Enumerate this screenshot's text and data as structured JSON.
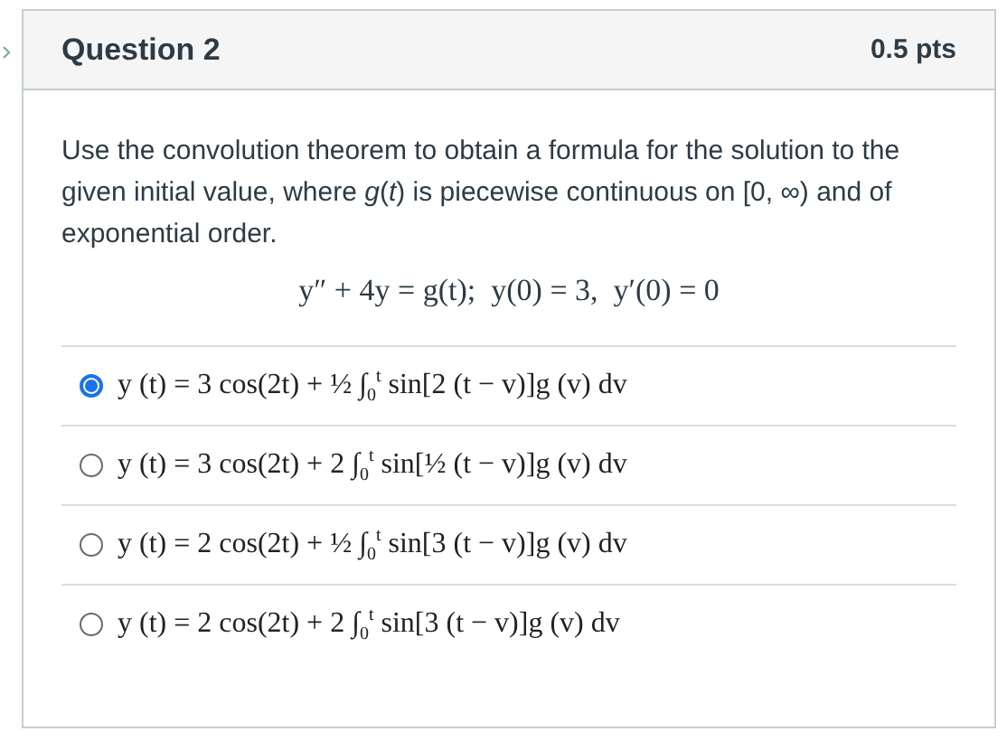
{
  "question": {
    "title": "Question 2",
    "points": "0.5 pts",
    "prompt": "Use the convolution theorem to obtain a formula for the solution to the given initial value, where *g*(*t*) is piecewise continuous on [0, ∞) and of exponential order.",
    "equation": "y″ + 4y = g(t);  y(0) = 3,  y′(0) = 0",
    "answers": [
      {
        "text": "y (t) = 3 cos(2t) + ½ ∫$_{0}$$^{t}$ sin[2 (t − v)]g (v) dv",
        "selected": true
      },
      {
        "text": "y (t) = 3 cos(2t) + 2 ∫$_{0}$$^{t}$ sin[½ (t − v)]g (v) dv",
        "selected": false
      },
      {
        "text": "y (t) = 2 cos(2t) + ½ ∫$_{0}$$^{t}$ sin[3 (t − v)]g (v) dv",
        "selected": false
      },
      {
        "text": "y (t) = 2 cos(2t) + 2 ∫$_{0}$$^{t}$ sin[3 (t − v)]g (v) dv",
        "selected": false
      }
    ]
  }
}
